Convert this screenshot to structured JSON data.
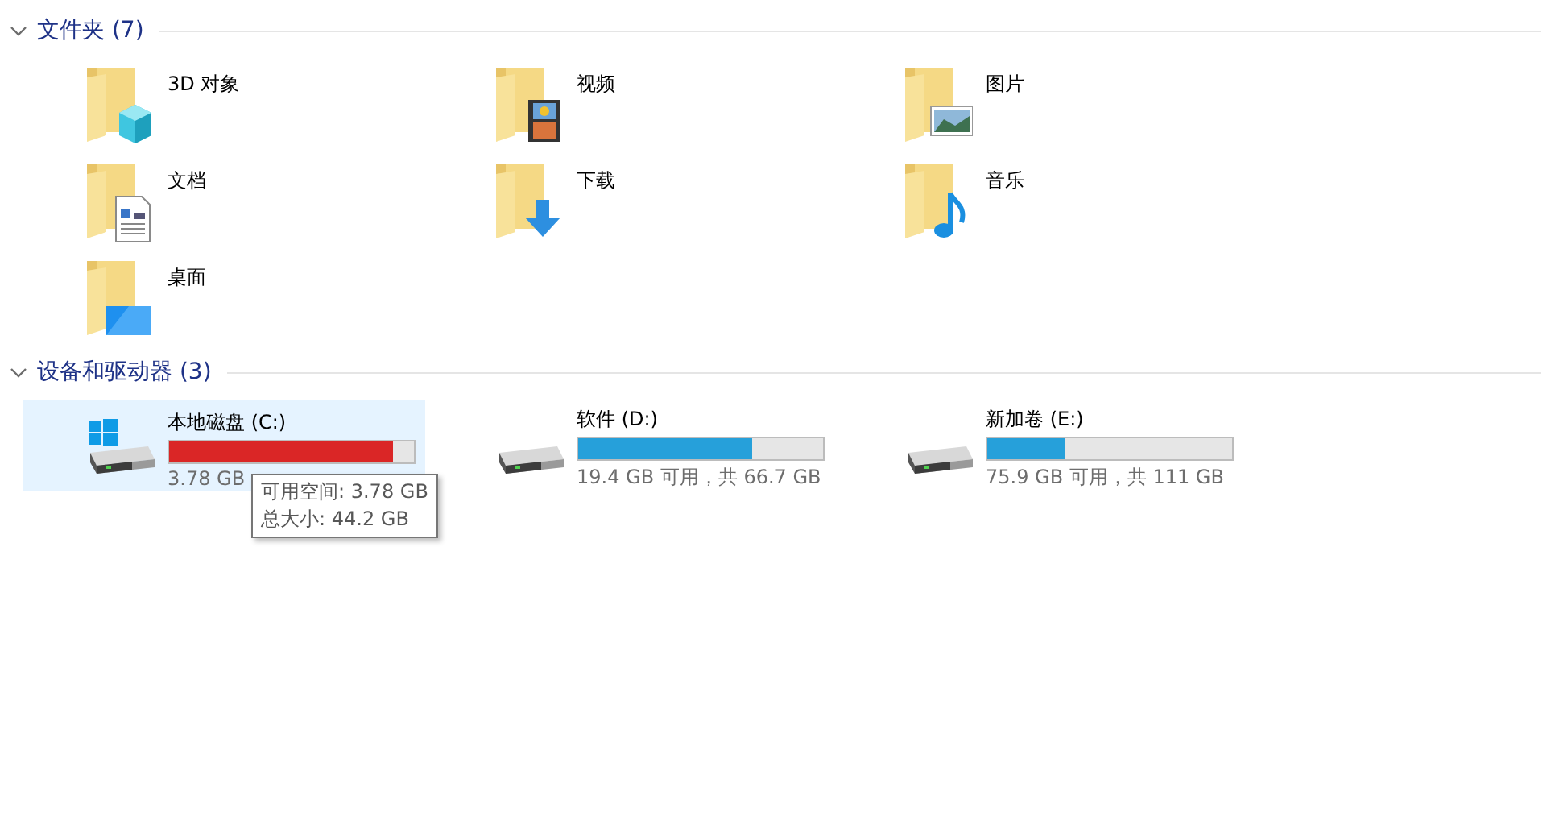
{
  "sections": [
    {
      "kind": "folders",
      "title": "文件夹 (7)",
      "items": [
        {
          "name": "3D 对象",
          "kind": "cube"
        },
        {
          "name": "视频",
          "kind": "film"
        },
        {
          "name": "图片",
          "kind": "photo"
        },
        {
          "name": "文档",
          "kind": "document"
        },
        {
          "name": "下载",
          "kind": "download"
        },
        {
          "name": "音乐",
          "kind": "music"
        },
        {
          "name": "桌面",
          "kind": "desktop"
        }
      ]
    },
    {
      "kind": "drives",
      "title": "设备和驱动器 (3)",
      "items": [
        {
          "name": "本地磁盘 (C:)",
          "system": true,
          "selected": true,
          "low_space": true,
          "level": 0.914,
          "usage": "3.78 GB",
          "tooltip": [
            "可用空间: 3.78 GB",
            "总大小: 44.2 GB"
          ]
        },
        {
          "name": "软件 (D:)",
          "system": false,
          "selected": false,
          "low_space": false,
          "level": 0.709,
          "usage": "19.4 GB 可用，共 66.7 GB"
        },
        {
          "name": "新加卷 (E:)",
          "system": false,
          "selected": false,
          "low_space": false,
          "level": 0.316,
          "usage": "75.9 GB 可用，共 111 GB"
        }
      ]
    }
  ]
}
